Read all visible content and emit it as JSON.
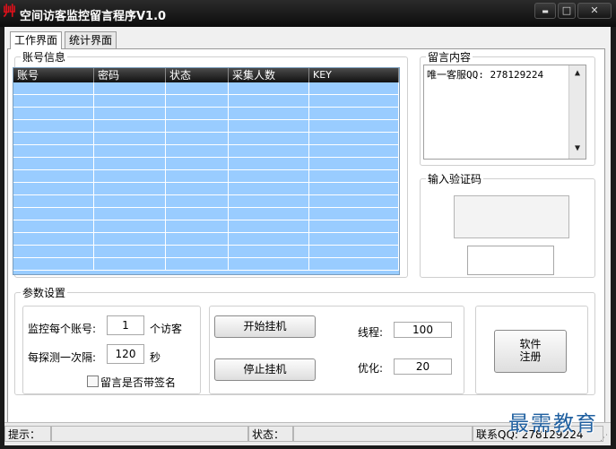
{
  "window": {
    "title": "空间访客监控留言程序V1.0",
    "app_icon_glyph": "艸",
    "app_icon_name": "app-icon",
    "minimize_glyph": "▬",
    "maximize_glyph": "□",
    "close_glyph": "✕"
  },
  "tabs": [
    {
      "label": "工作界面",
      "active": true
    },
    {
      "label": "统计界面",
      "active": false
    }
  ],
  "accounts": {
    "group_label": "账号信息",
    "columns": [
      "账号",
      "密码",
      "状态",
      "采集人数",
      "KEY"
    ],
    "row_count": 15
  },
  "message": {
    "group_label": "留言内容",
    "text": "唯一客服QQ: 278129224",
    "scroll_up": "▲",
    "scroll_down": "▼"
  },
  "captcha": {
    "group_label": "输入验证码",
    "input_value": ""
  },
  "params": {
    "group_label": "参数设置",
    "visitors_per_account_label": "监控每个账号:",
    "visitors_per_account_value": "1",
    "visitors_unit": "个访客",
    "interval_label": "每探测一次隔:",
    "interval_value": "120",
    "interval_unit": "秒",
    "signature_checkbox_label": "留言是否带签名",
    "signature_checked": false
  },
  "controls": {
    "start_label": "开始挂机",
    "stop_label": "停止挂机",
    "threads_label": "线程:",
    "threads_value": "100",
    "optimize_label": "优化:",
    "optimize_value": "20",
    "register_label_line1": "软件",
    "register_label_line2": "注册"
  },
  "statusbar": {
    "hint_label": "提示：",
    "hint_value": "",
    "status_label": "状态：",
    "status_value": "",
    "contact": "联系QQ: 278129224"
  },
  "watermark": "最需教育",
  "colors": {
    "grid_fill": "#99ccff",
    "title_bar": "#111111"
  }
}
